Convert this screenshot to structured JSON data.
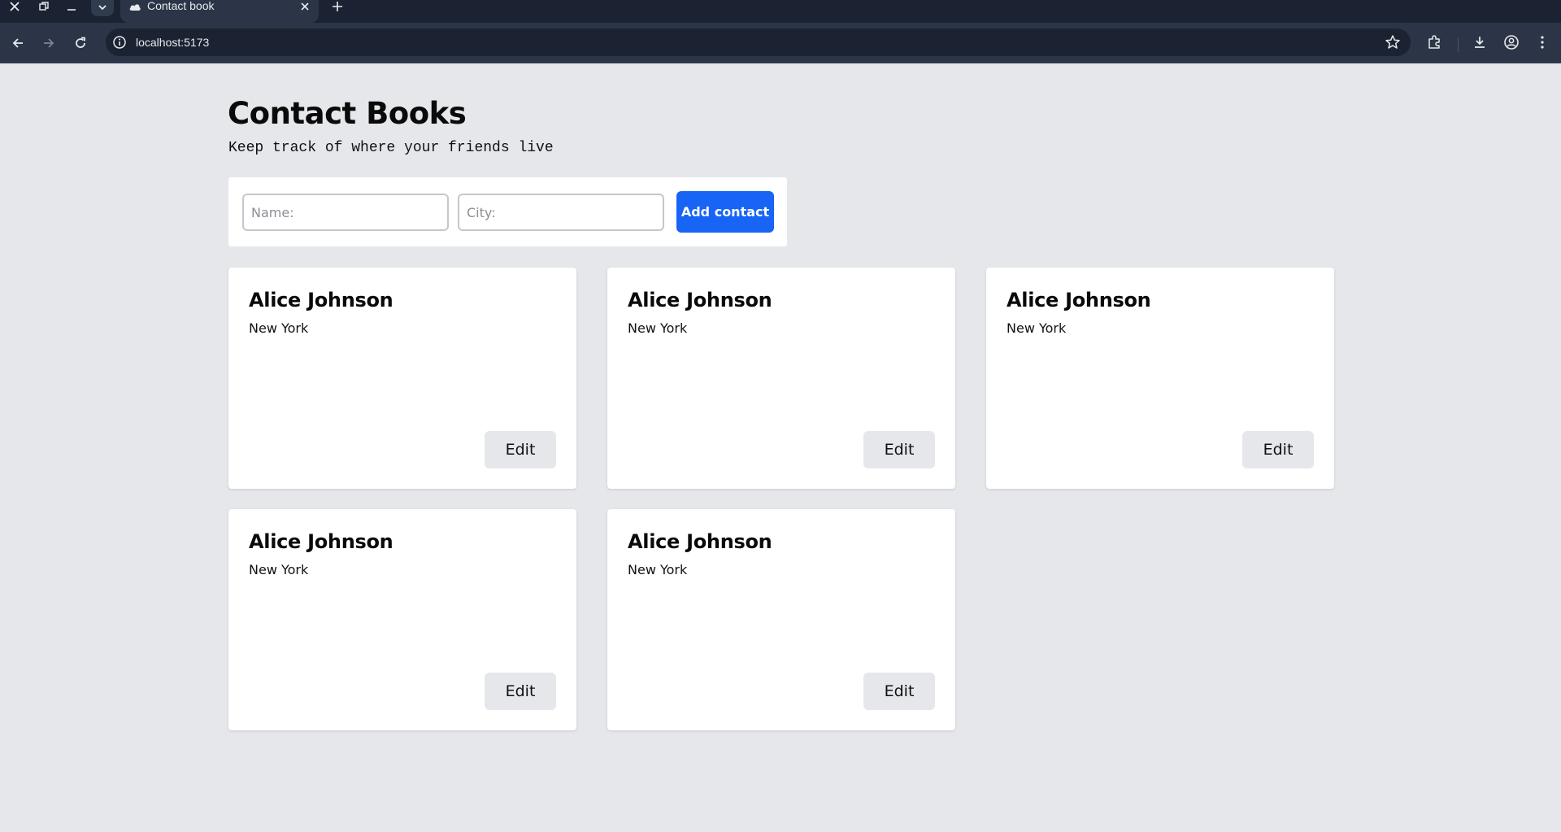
{
  "browser": {
    "tab_title": "Contact book",
    "url": "localhost:5173"
  },
  "page": {
    "title": "Contact Books",
    "subtitle": "Keep track of where your friends live"
  },
  "form": {
    "name_placeholder": "Name:",
    "city_placeholder": "City:",
    "name_value": "",
    "city_value": "",
    "submit_label": "Add contact"
  },
  "contacts": [
    {
      "name": "Alice Johnson",
      "city": "New York",
      "edit_label": "Edit"
    },
    {
      "name": "Alice Johnson",
      "city": "New York",
      "edit_label": "Edit"
    },
    {
      "name": "Alice Johnson",
      "city": "New York",
      "edit_label": "Edit"
    },
    {
      "name": "Alice Johnson",
      "city": "New York",
      "edit_label": "Edit"
    },
    {
      "name": "Alice Johnson",
      "city": "New York",
      "edit_label": "Edit"
    }
  ],
  "colors": {
    "accent": "#1764f5",
    "page_background": "#e5e7eb",
    "chrome_dark": "#1b2332"
  }
}
